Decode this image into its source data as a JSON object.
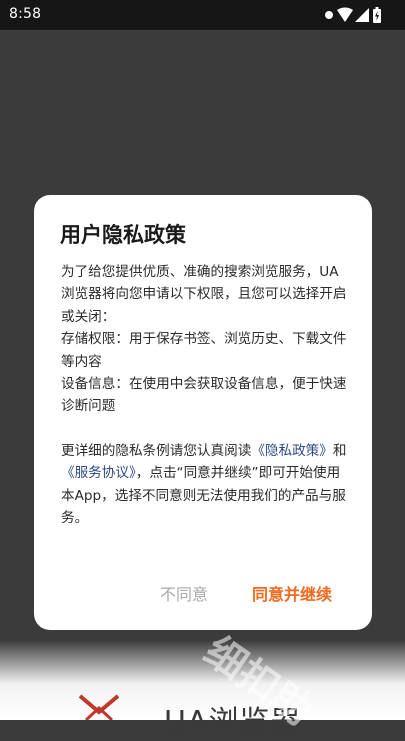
{
  "status_bar": {
    "time": "8:58",
    "icons": [
      "notification-dot-icon",
      "wifi-icon",
      "signal-icon",
      "battery-icon"
    ]
  },
  "background": {
    "app_name": "UA浏览器",
    "watermark": "细扣助"
  },
  "dialog": {
    "title": "用户隐私政策",
    "intro": "为了给您提供优质、准确的搜索浏览服务，UA浏览器将向您申请以下权限，且您可以选择开启或关闭：",
    "storage_permission": "存储权限：用于保存书签、浏览历史、下载文件等内容",
    "device_info": "设备信息：在使用中会获取设备信息，便于快速诊断问题",
    "detail_prefix": "更详细的隐私条例请您认真阅读",
    "privacy_link": "《隐私政策》",
    "and": "和",
    "service_link": "《服务协议》",
    "detail_suffix": "，点击“同意并继续”即可开始使用本App，选择不同意则无法使用我们的产品与服务。",
    "disagree_label": "不同意",
    "agree_label": "同意并继续"
  },
  "colors": {
    "scrim": "#3b3b3b",
    "link": "#2d4a86",
    "agree": "#f06a20",
    "disagree": "#a9a9a9"
  }
}
